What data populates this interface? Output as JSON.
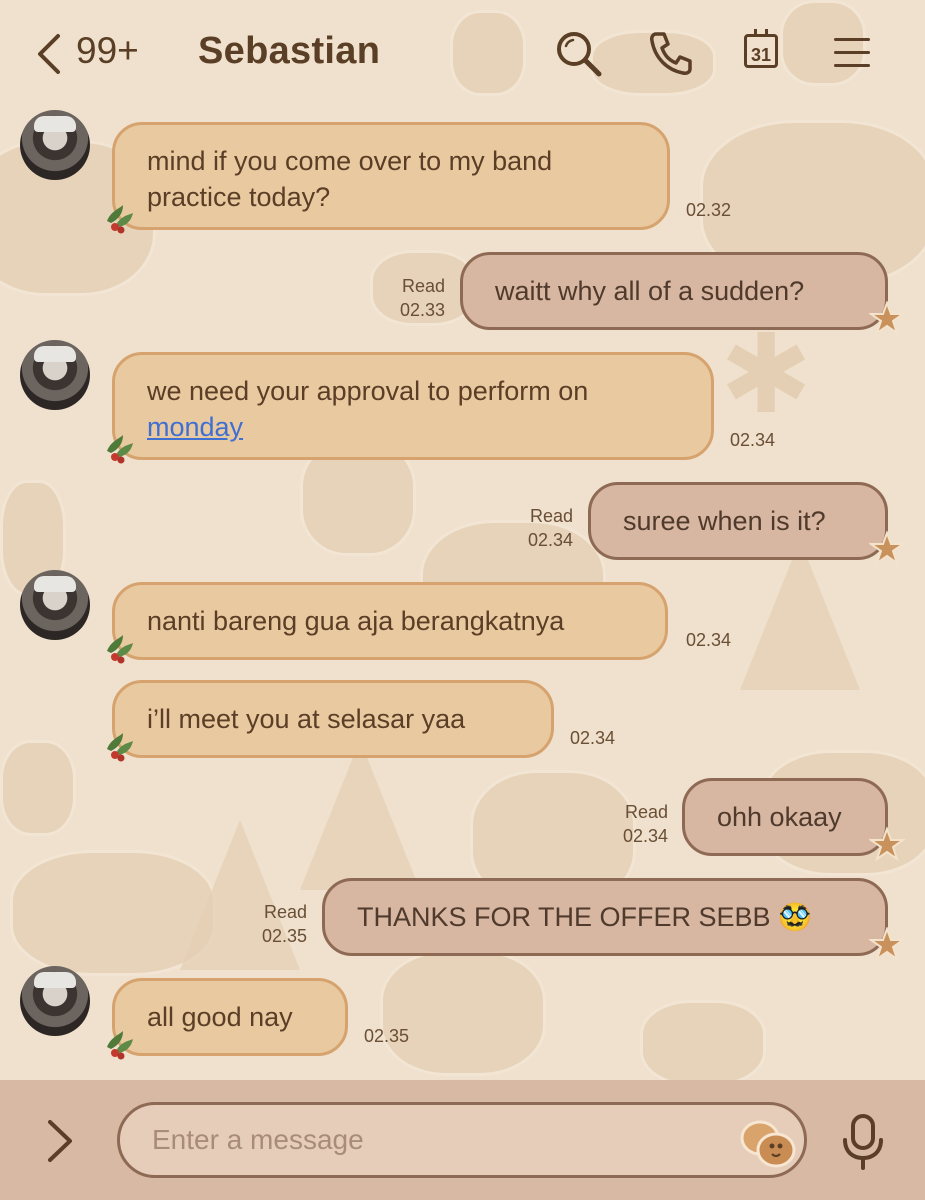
{
  "header": {
    "unread_count": "99+",
    "contact_name": "Sebastian",
    "calendar_day": "31"
  },
  "messages": [
    {
      "direction": "in",
      "lines": [
        "mind if you come over to my band",
        "practice today?"
      ],
      "time": "02.32"
    },
    {
      "direction": "out",
      "text": "waitt why all of a sudden?",
      "status": "Read",
      "time": "02.33"
    },
    {
      "direction": "in",
      "line1": "we need your approval to perform on",
      "link": "monday",
      "time": "02.34"
    },
    {
      "direction": "out",
      "text": "suree when is it?",
      "status": "Read",
      "time": "02.34"
    },
    {
      "direction": "in",
      "text": "nanti bareng gua aja berangkatnya",
      "time": "02.34"
    },
    {
      "direction": "in",
      "text": "i’ll meet you at selasar yaa",
      "time": "02.34"
    },
    {
      "direction": "out",
      "text": "ohh okaay",
      "status": "Read",
      "time": "02.34"
    },
    {
      "direction": "out",
      "text": "THANKS FOR THE OFFER SEBB 🥸",
      "status": "Read",
      "time": "02.35"
    },
    {
      "direction": "in",
      "text": "all good nay",
      "time": "02.35"
    }
  ],
  "composer": {
    "placeholder": "Enter a message"
  },
  "colors": {
    "background": "#efe1cd",
    "incoming_bubble": "#e9c9a0",
    "outgoing_bubble": "#d7b6a2",
    "text": "#5a3e26",
    "link": "#3f6fd1"
  },
  "icons": [
    "back-chevron-icon",
    "search-icon",
    "phone-icon",
    "calendar-icon",
    "menu-icon",
    "holly-icon",
    "star-cookie-icon",
    "expand-chevron-icon",
    "sticker-icon",
    "microphone-icon"
  ]
}
